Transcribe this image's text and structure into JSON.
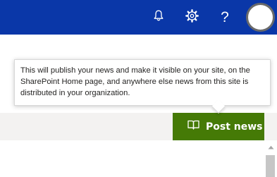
{
  "header": {
    "background": "#0a37a8",
    "icons": [
      "bell-icon",
      "gear-icon",
      "help-icon",
      "avatar"
    ],
    "help_glyph": "?"
  },
  "teaching_bubble": {
    "text": "This will publish your news and make it visible on your site, on the SharePoint Home page, and anywhere else news from this site is distributed in your organization."
  },
  "command_bar": {
    "post_button": {
      "label": "Post news",
      "icon": "book-icon",
      "color": "#457a06"
    }
  }
}
